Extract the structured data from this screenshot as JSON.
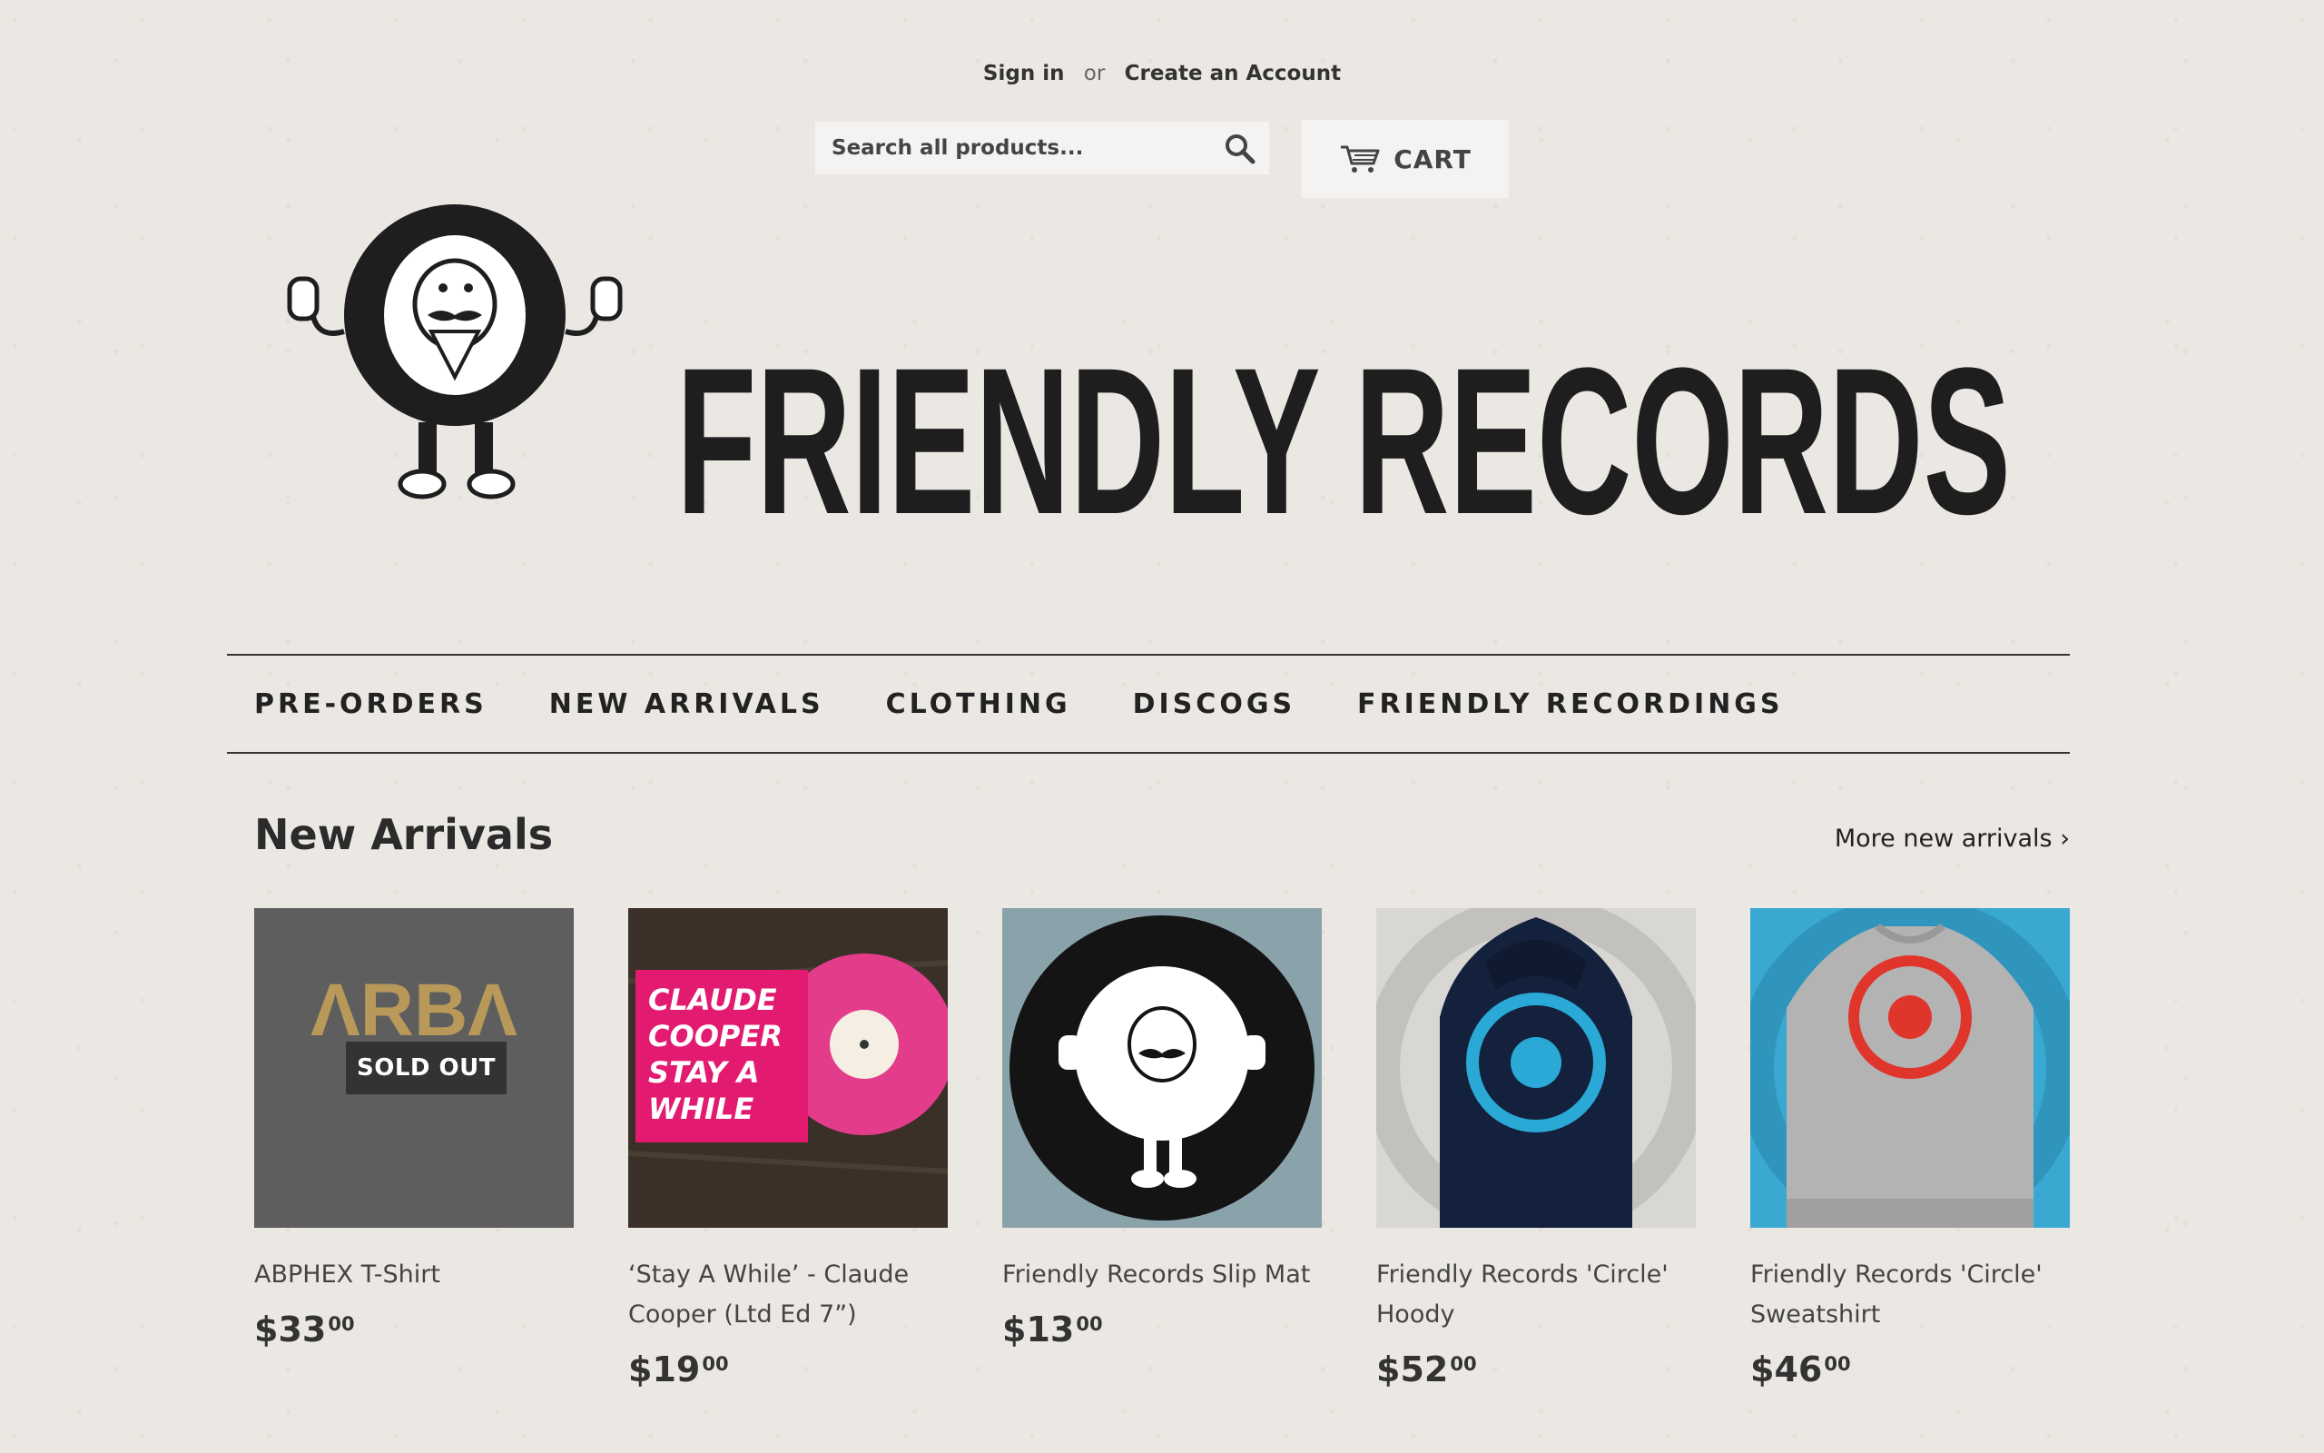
{
  "account": {
    "sign_in": "Sign in",
    "or": "or",
    "create": "Create an Account"
  },
  "search": {
    "placeholder": "Search all products..."
  },
  "cart": {
    "label": "CART"
  },
  "logo": {
    "text": "FRIENDLY RECORDS"
  },
  "nav": [
    "PRE-ORDERS",
    "NEW ARRIVALS",
    "CLOTHING",
    "DISCOGS",
    "FRIENDLY RECORDINGS"
  ],
  "section": {
    "title": "New Arrivals",
    "more": "More new arrivals ›"
  },
  "products": [
    {
      "title": "ABPHEX T-Shirt",
      "price_main": "$33",
      "price_cents": "00",
      "badge": "SOLD OUT",
      "thumb_text": "ΛRBΛ"
    },
    {
      "title": "‘Stay A While’ - Claude Cooper (Ltd Ed 7”)",
      "price_main": "$19",
      "price_cents": "00",
      "thumb_text": "CLAUDE COOPER STAY A WHILE"
    },
    {
      "title": "Friendly Records Slip Mat",
      "price_main": "$13",
      "price_cents": "00"
    },
    {
      "title": "Friendly Records 'Circle' Hoody",
      "price_main": "$52",
      "price_cents": "00"
    },
    {
      "title": "Friendly Records 'Circle' Sweatshirt",
      "price_main": "$46",
      "price_cents": "00"
    }
  ],
  "colors": {
    "background": "#ebe8e3",
    "text": "#333333",
    "hoody_print": "#2aa9d6",
    "sweatshirt_print": "#e0352b"
  }
}
